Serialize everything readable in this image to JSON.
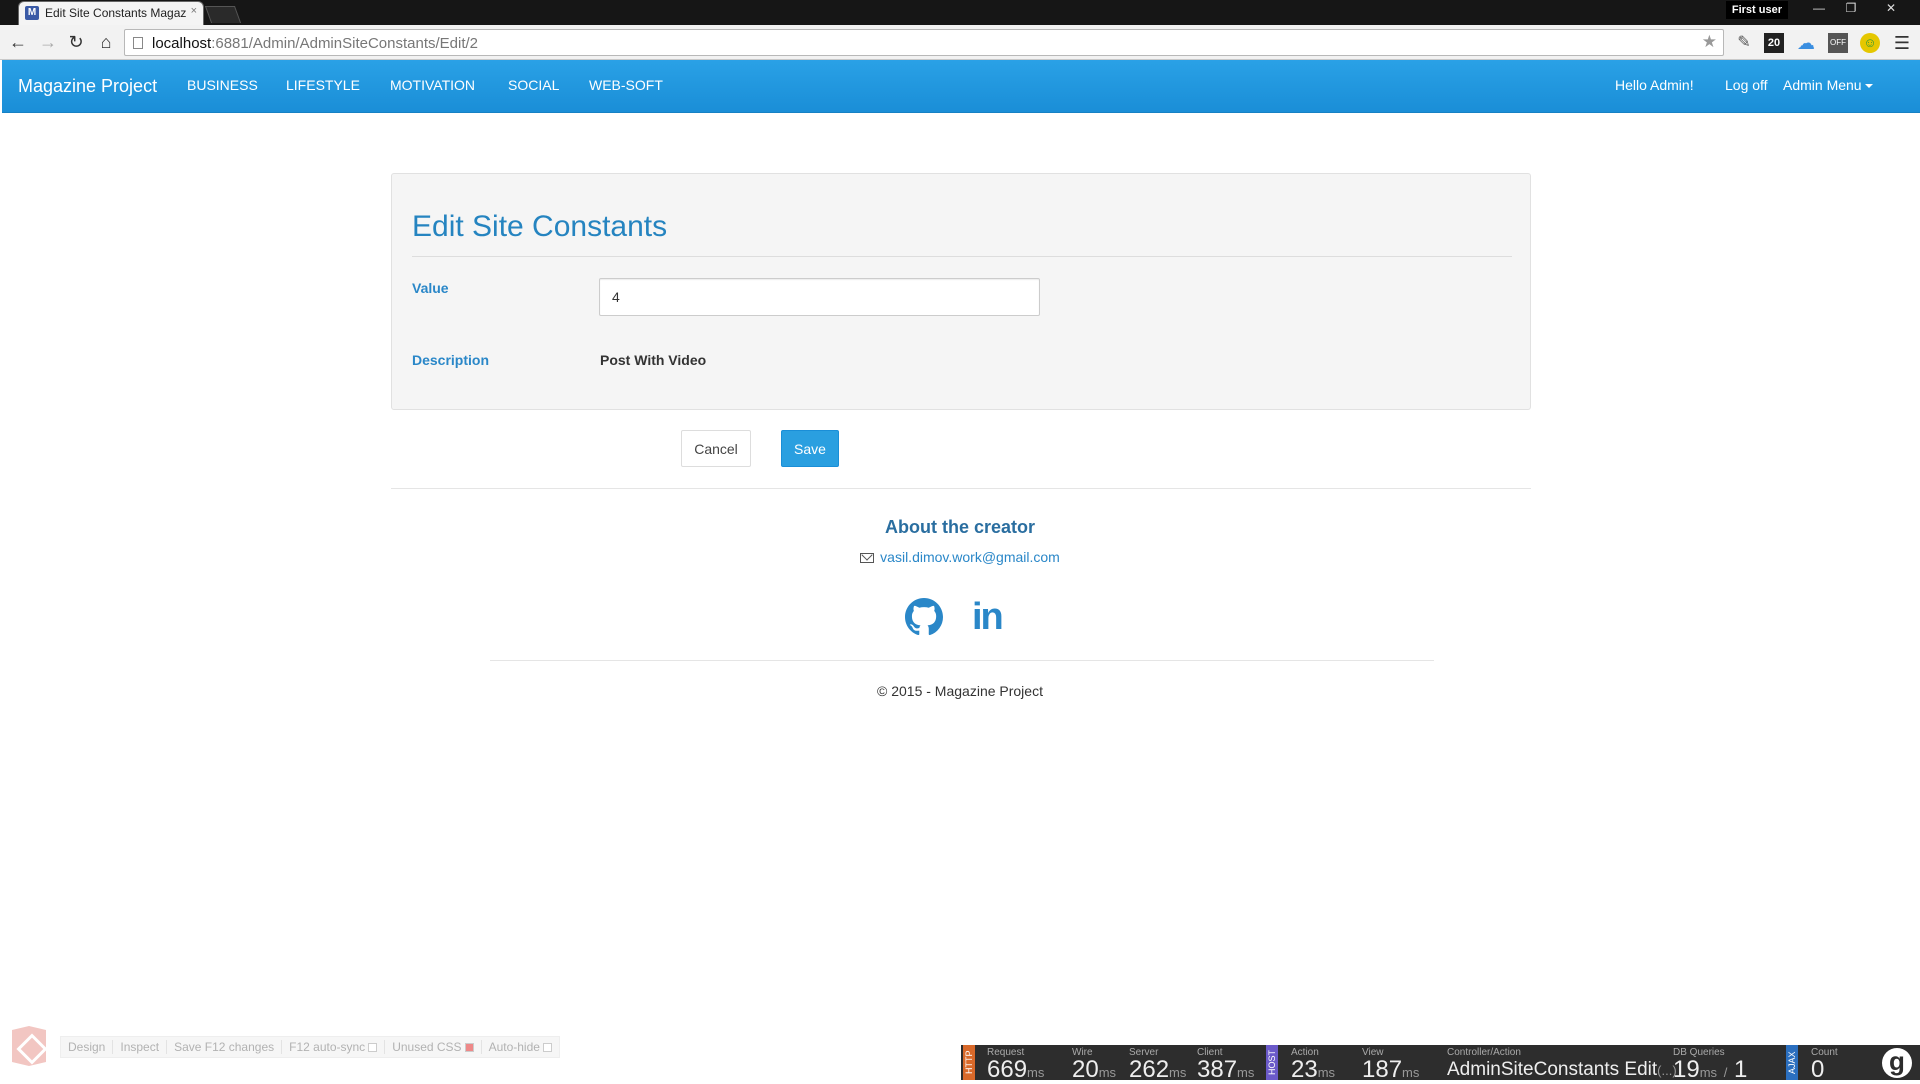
{
  "browser": {
    "tab_title": "Edit Site Constants Magaz",
    "tab_close": "×",
    "profile_user": "First user",
    "url_host": "localhost",
    "url_rest": ":6881/Admin/AdminSiteConstants/Edit/2",
    "ext_badge": "20",
    "ext_off": "OFF"
  },
  "navbar": {
    "brand": "Magazine Project",
    "items": [
      "BUSINESS",
      "LIFESTYLE",
      "MOTIVATION",
      "SOCIAL",
      "WEB-SOFT"
    ],
    "hello": "Hello Admin!",
    "logoff": "Log off",
    "admin_menu": "Admin Menu",
    "color": "#1e96dc"
  },
  "form": {
    "title": "Edit Site Constants",
    "value_label": "Value",
    "value": "4",
    "description_label": "Description",
    "description_value": "Post With Video",
    "cancel_label": "Cancel",
    "save_label": "Save"
  },
  "footer": {
    "about_title": "About the creator",
    "email": "vasil.dimov.work@gmail.com",
    "linkedin": "in",
    "copyright": "© 2015 - Magazine Project"
  },
  "browser_link": {
    "items": [
      "Design",
      "Inspect",
      "Save F12 changes",
      "F12 auto-sync",
      "Unused CSS",
      "Auto-hide"
    ]
  },
  "glimpse": {
    "http_tag": "HTTP",
    "host_tag": "HOST",
    "ajax_tag": "AJAX",
    "request_label": "Request",
    "request_value": "669",
    "request_unit": "ms",
    "wire_label": "Wire",
    "wire_value": "20",
    "wire_unit": "ms",
    "server_label": "Server",
    "server_value": "262",
    "server_unit": "ms",
    "client_label": "Client",
    "client_value": "387",
    "client_unit": "ms",
    "action_label": "Action",
    "action_value": "23",
    "action_unit": "ms",
    "view_label": "View",
    "view_value": "187",
    "view_unit": "ms",
    "controller_label": "Controller/Action",
    "controller_value": "AdminSiteConstants Edit",
    "controller_more": "(...)",
    "db_label": "DB Queries",
    "db_time": "19",
    "db_unit": "ms",
    "db_sep": "/",
    "db_count": "1",
    "ajax_label": "Count",
    "ajax_count": "0",
    "logo": "g"
  }
}
